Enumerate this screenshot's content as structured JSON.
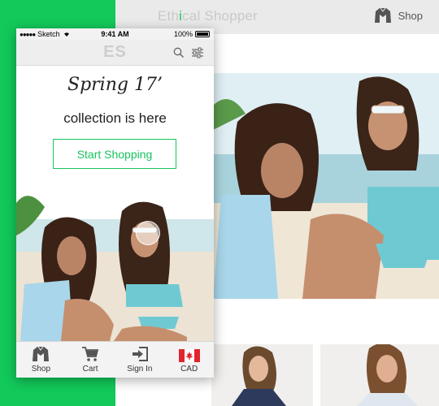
{
  "desktop": {
    "site_title_prefix": "Eth",
    "site_title_accent": "i",
    "site_title_suffix": "cal Shopper",
    "shop_label": "Shop"
  },
  "phone": {
    "status_bar": {
      "carrier": "Sketch",
      "time": "9:41 AM",
      "battery": "100%"
    },
    "logo": "ES",
    "hero": {
      "headline": "Spring 17’",
      "subline": "collection is here",
      "cta": "Start Shopping"
    },
    "tabs": [
      {
        "label": "Shop",
        "icon": "jacket-icon"
      },
      {
        "label": "Cart",
        "icon": "cart-icon"
      },
      {
        "label": "Sign In",
        "icon": "sign-in-icon"
      },
      {
        "label": "CAD",
        "icon": "canada-flag-icon"
      }
    ]
  },
  "colors": {
    "backdrop_green": "#12c95a",
    "brand_accent": "#19c95f"
  }
}
